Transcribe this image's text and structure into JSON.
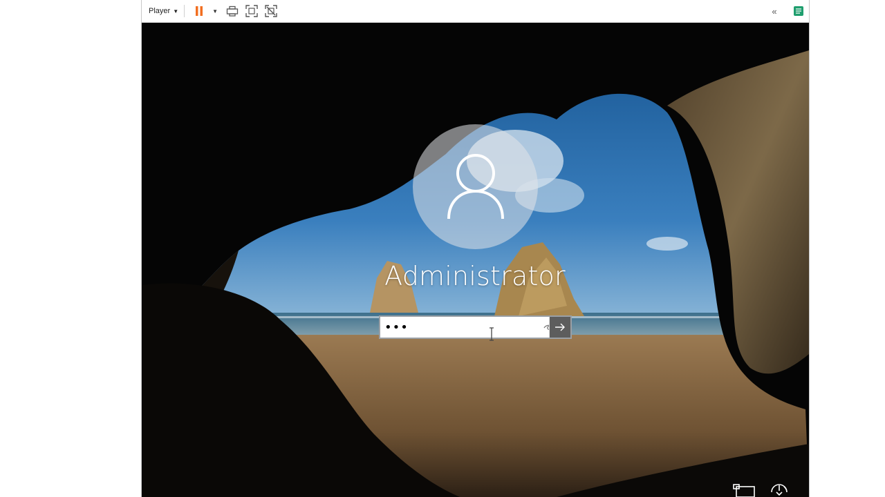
{
  "toolbar": {
    "player_label": "Player",
    "accent_pause": "#f26f21",
    "accent_unity": "#1f9e6e",
    "icons": [
      "pause-icon",
      "dropdown-icon",
      "send-ctrl-alt-del-icon",
      "full-screen-icon",
      "unity-icon",
      "collapse-icon",
      "unity-library-icon"
    ]
  },
  "lock_screen": {
    "user_name": "Administrator",
    "password_value": "•••",
    "icons": [
      "user-icon",
      "reveal-password-icon",
      "submit-arrow-icon",
      "network-icon",
      "ease-of-access-icon"
    ]
  },
  "colors": {
    "avatar_bg": "#e1e4e8",
    "submit_bg": "#5d5d5d",
    "sky": "#3a79b6",
    "sand": "#8a6a44"
  }
}
